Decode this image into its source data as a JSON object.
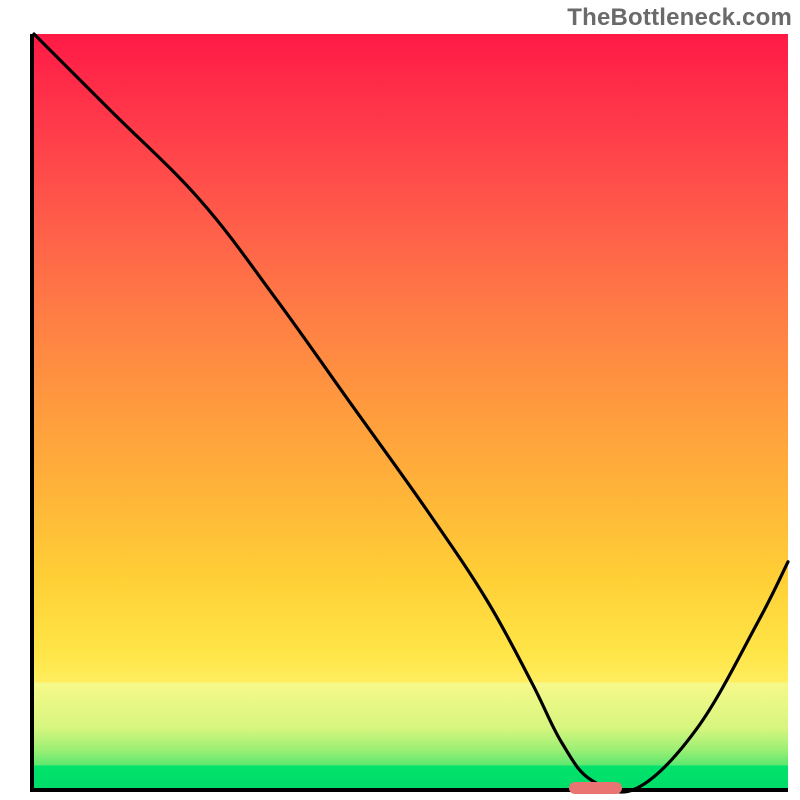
{
  "attribution": "TheBottleneck.com",
  "chart_data": {
    "type": "line",
    "title": "",
    "xlabel": "",
    "ylabel": "",
    "xlim": [
      0,
      100
    ],
    "ylim": [
      0,
      100
    ],
    "grid": false,
    "legend": false,
    "background_gradient": {
      "direction": "vertical",
      "stops": [
        {
          "pos": 0.0,
          "color": "#ff1a46"
        },
        {
          "pos": 0.5,
          "color": "#ff973f"
        },
        {
          "pos": 0.82,
          "color": "#ffe547"
        },
        {
          "pos": 0.94,
          "color": "#f7f98a"
        },
        {
          "pos": 0.975,
          "color": "#4de66f"
        },
        {
          "pos": 1.0,
          "color": "#00e36b"
        }
      ]
    },
    "series": [
      {
        "name": "bottleneck-curve",
        "x": [
          0,
          10,
          22,
          32,
          42,
          52,
          60,
          66,
          70,
          74,
          80,
          88,
          96,
          100
        ],
        "y": [
          100,
          90,
          78,
          65,
          51,
          37,
          25,
          14,
          6,
          1,
          0,
          8,
          22,
          30
        ]
      }
    ],
    "annotations": [
      {
        "name": "optimal-marker",
        "type": "pill",
        "x_start": 71,
        "x_end": 78,
        "y": 0,
        "color": "#e97472"
      }
    ]
  }
}
